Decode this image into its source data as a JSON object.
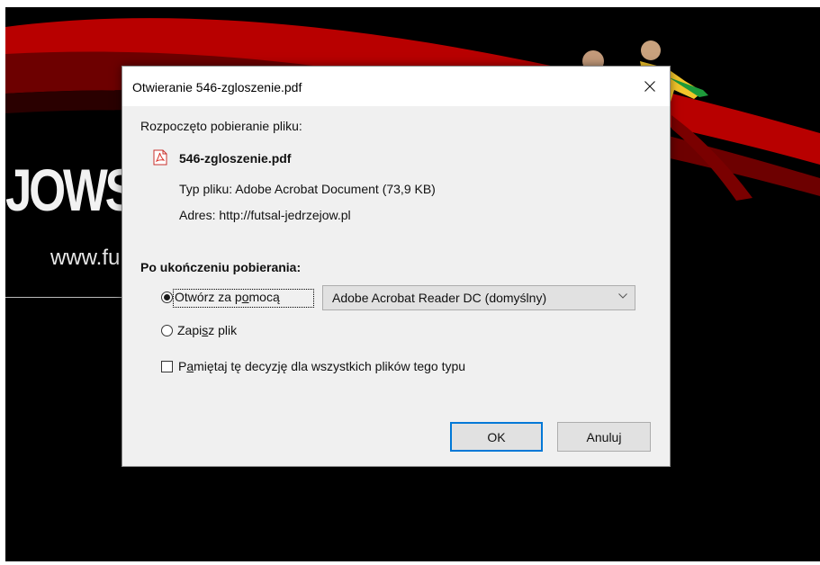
{
  "background": {
    "logo_text": "JOWS",
    "url_text": "www.fu"
  },
  "dialog": {
    "title": "Otwieranie 546-zgloszenie.pdf",
    "intro": "Rozpoczęto pobieranie pliku:",
    "file_name": "546-zgloszenie.pdf",
    "file_type_label": "Typ pliku:",
    "file_type_value": "Adobe Acrobat Document (73,9 KB)",
    "address_label": "Adres:",
    "address_value": "http://futsal-jedrzejow.pl",
    "after_download_heading": "Po ukończeniu pobierania:",
    "open_with": {
      "pre": "Otwórz za p",
      "key": "o",
      "post": "mocą",
      "selected": true
    },
    "app_select": {
      "value": "Adobe Acrobat Reader DC  (domyślny)"
    },
    "save_file": {
      "pre": "Zapi",
      "key": "s",
      "post": "z plik",
      "selected": false
    },
    "remember": {
      "pre": "P",
      "key": "a",
      "post": "miętaj tę decyzję dla wszystkich plików tego typu",
      "checked": false
    },
    "ok_label": "OK",
    "cancel_label": "Anuluj",
    "accent_color": "#0078d7"
  }
}
